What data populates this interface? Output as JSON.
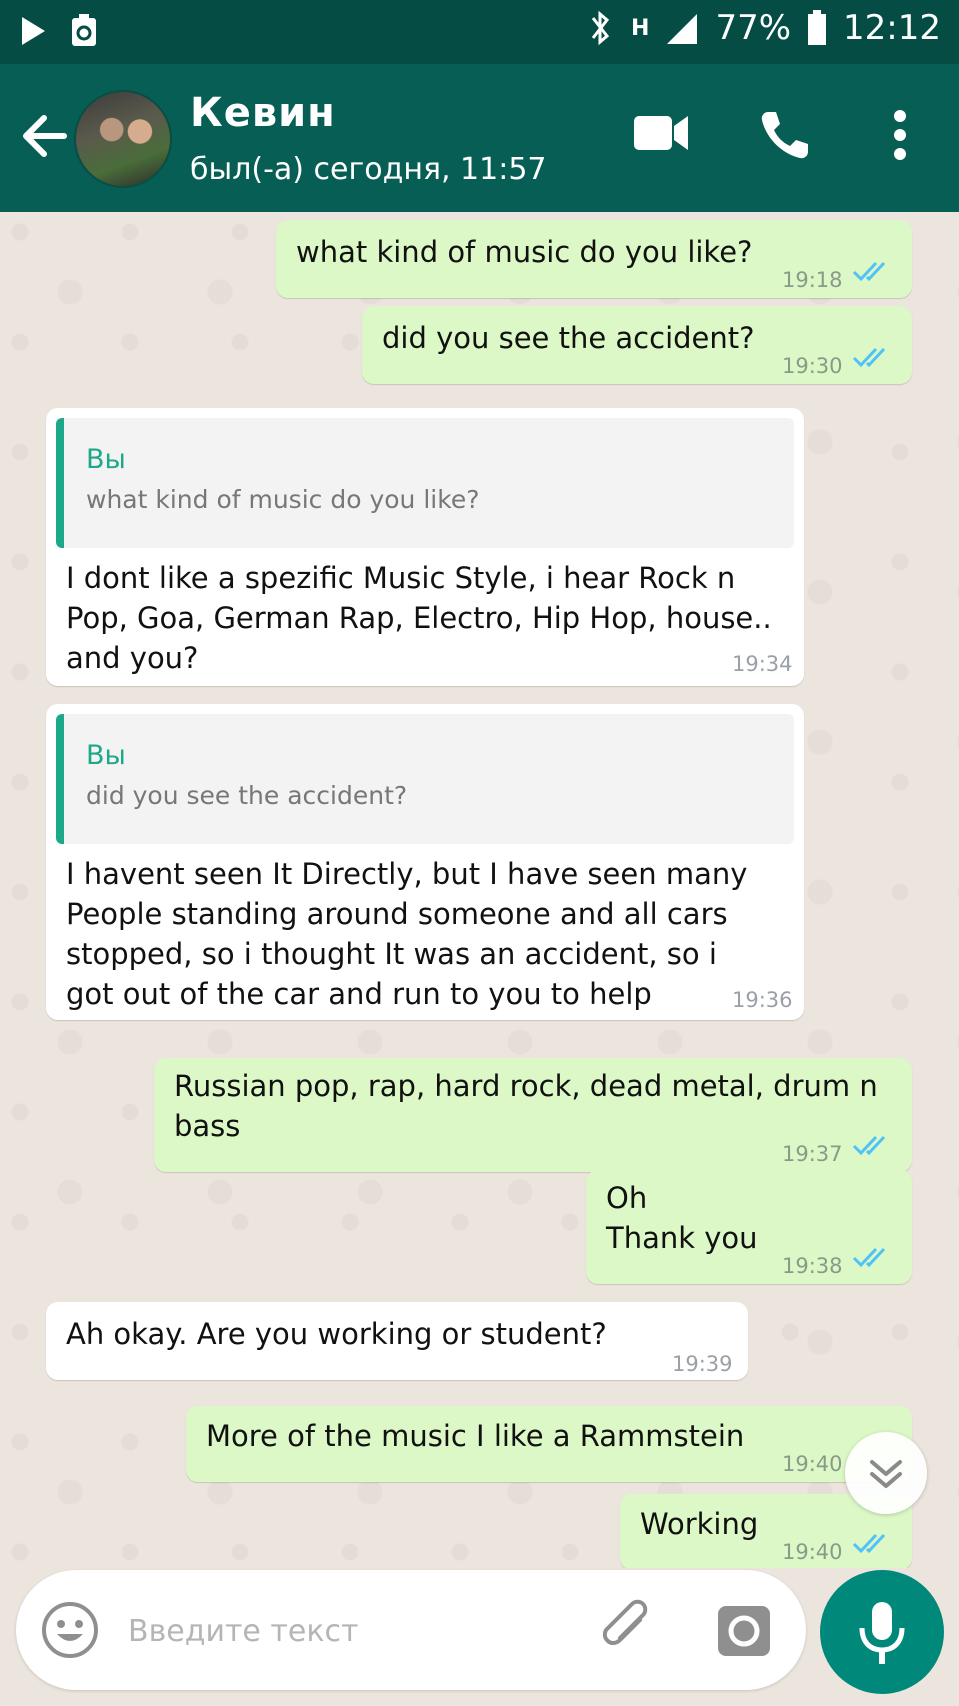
{
  "status_bar": {
    "network": "H",
    "battery": "77%",
    "time": "12:12"
  },
  "header": {
    "contact_name": "Кевин",
    "last_seen": "был(-а) сегодня, 11:57",
    "icons": [
      "back-arrow-icon",
      "video-call-icon",
      "phone-icon",
      "more-vert-icon"
    ]
  },
  "messages": [
    {
      "direction": "out",
      "text": "what kind of music do you like?",
      "time": "19:18",
      "read": true
    },
    {
      "direction": "out",
      "text": "did you see the accident?",
      "time": "19:30",
      "read": true
    },
    {
      "direction": "in",
      "quote_author": "Вы",
      "quote_text": "what kind of music do you like?",
      "text": "I dont like a spezific Music Style, i hear Rock n\nPop, Goa, German Rap, Electro, Hip Hop, house..\nand you?",
      "time": "19:34"
    },
    {
      "direction": "in",
      "quote_author": "Вы",
      "quote_text": "did you see the accident?",
      "text": "I havent seen It Directly, but I have seen many\nPeople standing around someone and all cars\nstopped, so i thought It was an accident, so i\ngot out of the car and run to you to help",
      "time": "19:36"
    },
    {
      "direction": "out",
      "text": "Russian pop, rap, hard rock, dead metal, drum n\nbass",
      "time": "19:37",
      "read": true
    },
    {
      "direction": "out",
      "text": "Oh\nThank you",
      "time": "19:38",
      "read": true
    },
    {
      "direction": "in",
      "text": "Ah okay. Are you working or student?",
      "time": "19:39"
    },
    {
      "direction": "out",
      "text": "More of the music I like a Rammstein",
      "time": "19:40",
      "read": true
    },
    {
      "direction": "out",
      "text": "Working",
      "time": "19:40",
      "read": true
    }
  ],
  "composer": {
    "placeholder": "Введите текст",
    "icons": [
      "emoji-icon",
      "attach-icon",
      "camera-icon",
      "mic-icon"
    ]
  },
  "colors": {
    "header": "#075E54",
    "status_bar": "#054D44",
    "outgoing_bubble": "#DCF8C6",
    "incoming_bubble": "#FFFFFF",
    "read_ticks": "#4FC3F7",
    "accent": "#00897B"
  }
}
